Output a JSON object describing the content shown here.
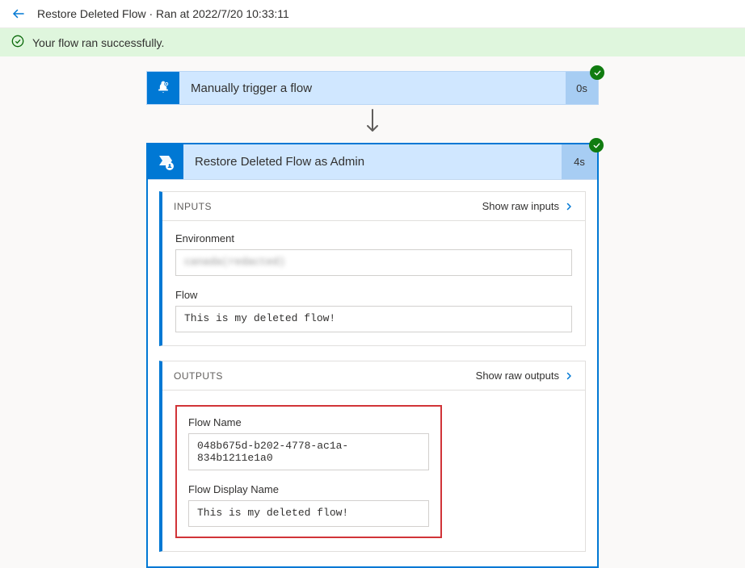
{
  "header": {
    "title": "Restore Deleted Flow · Ran at 2022/7/20 10:33:11"
  },
  "banner": {
    "message": "Your flow ran successfully."
  },
  "trigger": {
    "title": "Manually trigger a flow",
    "duration": "0s"
  },
  "action": {
    "title": "Restore Deleted Flow as Admin",
    "duration": "4s",
    "inputs": {
      "section_label": "Inputs",
      "show_raw_label": "Show raw inputs",
      "environment_label": "Environment",
      "environment_value": "canada(redacted)",
      "flow_label": "Flow",
      "flow_value": "This is my deleted flow!"
    },
    "outputs": {
      "section_label": "Outputs",
      "show_raw_label": "Show raw outputs",
      "flow_name_label": "Flow Name",
      "flow_name_value": "048b675d-b202-4778-ac1a-834b1211e1a0",
      "flow_display_name_label": "Flow Display Name",
      "flow_display_name_value": "This is my deleted flow!"
    }
  }
}
